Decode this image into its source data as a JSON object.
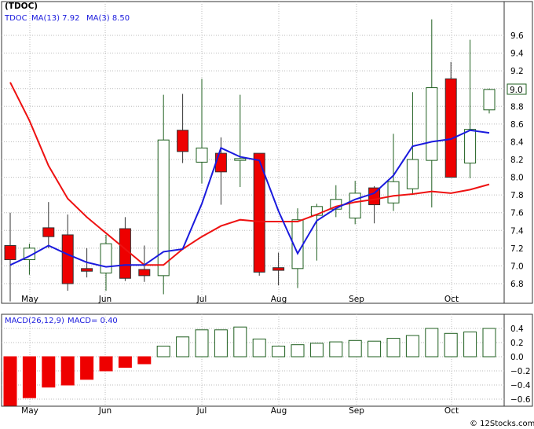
{
  "ticker_title": "(TDOC)",
  "price_panel": {
    "legend": {
      "symbol": "TDOC",
      "ma13": "MA(13)  7.92",
      "ma3": "MA(3)  8.50"
    },
    "last_price_label": "9.0"
  },
  "macd_panel": {
    "legend": {
      "params": "MACD(26,12,9)",
      "value": "MACD= 0.40"
    }
  },
  "watermark": "© 12Stocks.com",
  "colors": {
    "up_candle": "#1f5f1f",
    "down_candle": "#ee0000",
    "ma13": "#ee1111",
    "ma3": "#1a1add",
    "macd_positive": "#1f5f1f",
    "macd_negative": "#ee0000",
    "grid": "#bbbbbb"
  },
  "chart_data": [
    {
      "type": "candlestick",
      "title": "(TDOC)",
      "x": [
        "May",
        "Jun",
        "Jul",
        "Aug",
        "Sep",
        "Oct"
      ],
      "ylim": [
        6.6,
        9.8
      ],
      "yticks": [
        6.8,
        7.0,
        7.2,
        7.4,
        7.6,
        7.8,
        8.0,
        8.2,
        8.4,
        8.6,
        8.8,
        9.0,
        9.2,
        9.4,
        9.6
      ],
      "grid": true,
      "candles": [
        {
          "open": 7.23,
          "high": 7.6,
          "low": 6.6,
          "close": 7.07
        },
        {
          "open": 7.07,
          "high": 7.25,
          "low": 6.9,
          "close": 7.2
        },
        {
          "open": 7.43,
          "high": 7.72,
          "low": 7.2,
          "close": 7.33
        },
        {
          "open": 7.35,
          "high": 7.58,
          "low": 6.72,
          "close": 6.8
        },
        {
          "open": 6.97,
          "high": 7.2,
          "low": 6.87,
          "close": 6.94
        },
        {
          "open": 6.92,
          "high": 7.35,
          "low": 6.72,
          "close": 7.25
        },
        {
          "open": 7.42,
          "high": 7.55,
          "low": 6.83,
          "close": 6.86
        },
        {
          "open": 6.96,
          "high": 7.23,
          "low": 6.82,
          "close": 6.89
        },
        {
          "open": 6.89,
          "high": 8.93,
          "low": 6.68,
          "close": 8.42
        },
        {
          "open": 8.53,
          "high": 8.94,
          "low": 8.16,
          "close": 8.29
        },
        {
          "open": 8.17,
          "high": 9.11,
          "low": 7.93,
          "close": 8.33
        },
        {
          "open": 8.27,
          "high": 8.45,
          "low": 7.69,
          "close": 8.06
        },
        {
          "open": 8.19,
          "high": 8.93,
          "low": 7.89,
          "close": 8.21
        },
        {
          "open": 8.27,
          "high": 8.27,
          "low": 6.89,
          "close": 6.93
        },
        {
          "open": 6.98,
          "high": 7.15,
          "low": 6.78,
          "close": 6.95
        },
        {
          "open": 6.97,
          "high": 7.65,
          "low": 6.75,
          "close": 7.52
        },
        {
          "open": 7.57,
          "high": 7.7,
          "low": 7.06,
          "close": 7.67
        },
        {
          "open": 7.64,
          "high": 7.91,
          "low": 7.55,
          "close": 7.75
        },
        {
          "open": 7.54,
          "high": 7.96,
          "low": 7.47,
          "close": 7.82
        },
        {
          "open": 7.88,
          "high": 7.9,
          "low": 7.48,
          "close": 7.69
        },
        {
          "open": 7.71,
          "high": 8.49,
          "low": 7.62,
          "close": 7.95
        },
        {
          "open": 7.87,
          "high": 8.96,
          "low": 7.8,
          "close": 8.2
        },
        {
          "open": 8.19,
          "high": 9.78,
          "low": 7.66,
          "close": 9.01
        },
        {
          "open": 9.11,
          "high": 9.3,
          "low": 8.0,
          "close": 8.0
        },
        {
          "open": 8.16,
          "high": 9.55,
          "low": 7.99,
          "close": 8.54
        },
        {
          "open": 8.76,
          "high": 9.0,
          "low": 8.72,
          "close": 8.99
        }
      ],
      "series": [
        {
          "name": "MA(13)",
          "values": [
            9.07,
            8.64,
            8.13,
            7.76,
            7.55,
            7.37,
            7.19,
            7.01,
            7.01,
            7.19,
            7.33,
            7.45,
            7.52,
            7.5,
            7.5,
            7.5,
            7.58,
            7.67,
            7.72,
            7.75,
            7.79,
            7.81,
            7.84,
            7.82,
            7.86,
            7.92
          ]
        },
        {
          "name": "MA(3)",
          "values": [
            7.01,
            7.11,
            7.23,
            7.13,
            7.04,
            6.99,
            7.01,
            7.01,
            7.16,
            7.19,
            7.7,
            8.33,
            8.23,
            8.19,
            7.62,
            7.14,
            7.51,
            7.65,
            7.75,
            7.82,
            8.02,
            8.35,
            8.4,
            8.43,
            8.53,
            8.5
          ]
        }
      ]
    },
    {
      "type": "bar",
      "title": "MACD(26,12,9)",
      "x": [
        "May",
        "Jun",
        "Jul",
        "Aug",
        "Sep",
        "Oct"
      ],
      "ylim": [
        -0.7,
        0.48
      ],
      "yticks": [
        -0.6,
        -0.4,
        -0.2,
        0.0,
        0.2,
        0.4
      ],
      "grid": true,
      "series": [
        {
          "name": "MACD",
          "values": [
            -0.7,
            -0.58,
            -0.43,
            -0.4,
            -0.32,
            -0.2,
            -0.15,
            -0.1,
            0.15,
            0.28,
            0.38,
            0.38,
            0.42,
            0.25,
            0.15,
            0.17,
            0.19,
            0.21,
            0.23,
            0.22,
            0.26,
            0.3,
            0.4,
            0.33,
            0.35,
            0.4
          ]
        }
      ]
    }
  ]
}
